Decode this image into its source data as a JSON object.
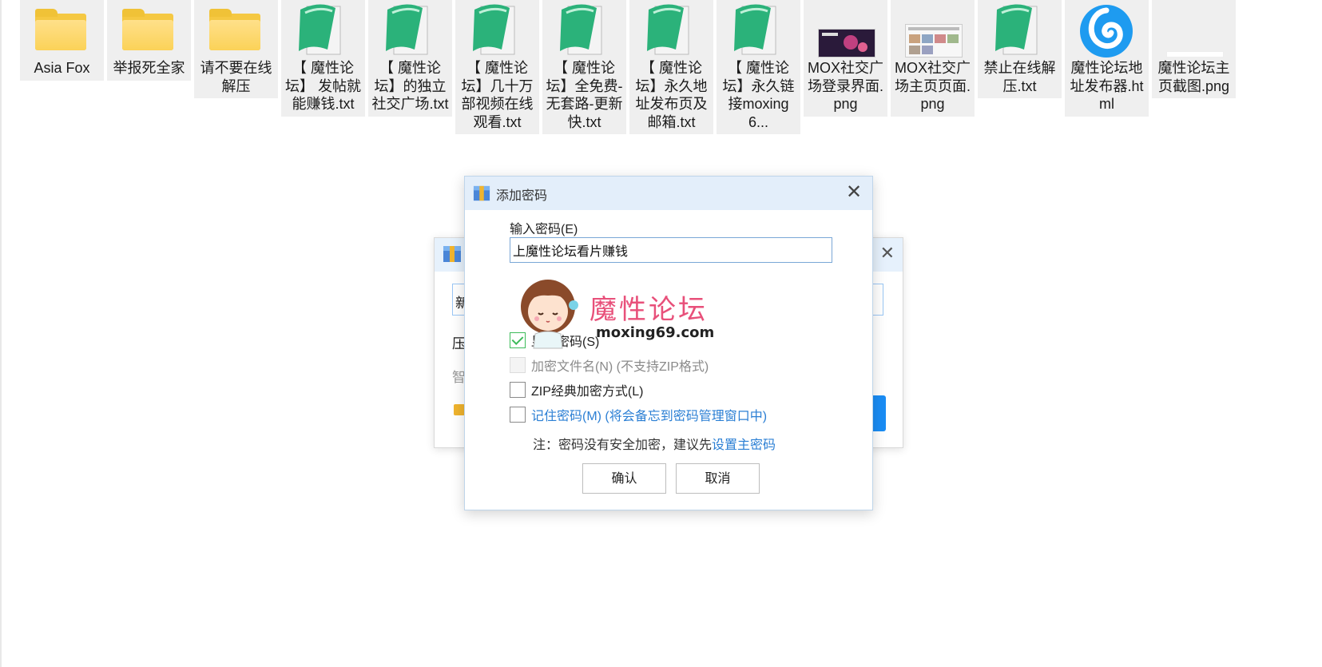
{
  "files": [
    {
      "label": "Asia Fox",
      "type": "folder"
    },
    {
      "label": "举报死全家",
      "type": "folder"
    },
    {
      "label": "请不要在线解压",
      "type": "folder"
    },
    {
      "label": "【 魔性论坛】 发帖就能赚钱.txt",
      "type": "txt"
    },
    {
      "label": "【 魔性论坛】的独立社交广场.txt",
      "type": "txt"
    },
    {
      "label": "【 魔性论坛】几十万部视频在线观看.txt",
      "type": "txt"
    },
    {
      "label": "【 魔性论坛】全免费-无套路-更新快.txt",
      "type": "txt"
    },
    {
      "label": "【 魔性论坛】永久地址发布页及邮箱.txt",
      "type": "txt"
    },
    {
      "label": "【 魔性论坛】永久链接moxing6...",
      "type": "txt"
    },
    {
      "label": "MOX社交广场登录界面.png",
      "type": "png"
    },
    {
      "label": "MOX社交广场主页页面.png",
      "type": "png"
    },
    {
      "label": "禁止在线解压.txt",
      "type": "txt"
    },
    {
      "label": "魔性论坛地址发布器.html",
      "type": "html"
    },
    {
      "label": "魔性论坛主页截图.png",
      "type": "png"
    }
  ],
  "back_dialog": {
    "input_text": "新",
    "label1": "压",
    "label2": "智"
  },
  "dialog": {
    "title": "添加密码",
    "close": "✕",
    "password_label": "输入密码(E)",
    "password_value": "上魔性论坛看片赚钱",
    "options": [
      {
        "label": "显示密码(S)",
        "checked": true,
        "disabled": false,
        "link": false
      },
      {
        "label": "加密文件名(N) (不支持ZIP格式)",
        "checked": false,
        "disabled": true,
        "link": false
      },
      {
        "label": "ZIP经典加密方式(L)",
        "checked": false,
        "disabled": false,
        "link": false
      },
      {
        "label": "记住密码(M) (将会备忘到密码管理窗口中)",
        "checked": false,
        "disabled": false,
        "link": true
      }
    ],
    "note_prefix": "注：密码没有安全加密，建议先",
    "note_link": "设置主密码",
    "ok_label": "确认",
    "cancel_label": "取消"
  },
  "watermark": {
    "title": "魔性论坛",
    "url": "moxing69.com"
  },
  "colors": {
    "header_bg": "#e3eefa",
    "link": "#2b7fd4",
    "checkbox_checked": "#3dbb5a",
    "watermark_pink": "#e8507a"
  }
}
